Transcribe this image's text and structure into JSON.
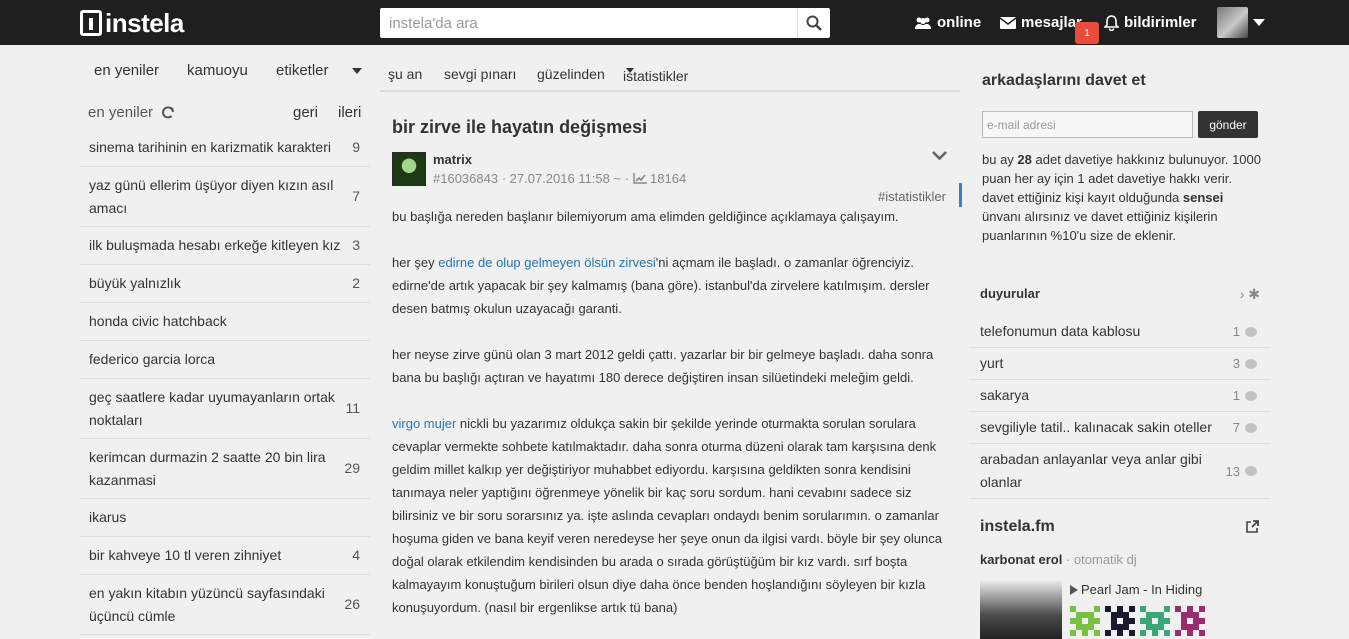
{
  "header": {
    "logo_text": "instela",
    "search_placeholder": "instela'da ara",
    "nav": {
      "online": "online",
      "messages": "mesajlar",
      "messages_badge": "1",
      "notifications": "bildirimler"
    }
  },
  "left": {
    "tabs": [
      "en yeniler",
      "kamuoyu",
      "etiketler"
    ],
    "list_title": "en yeniler",
    "back": "geri",
    "forward": "ileri",
    "topics": [
      {
        "title": "sinema tarihinin en karizmatik karakteri",
        "count": "9"
      },
      {
        "title": "yaz günü ellerim üşüyor diyen kızın asıl amacı",
        "count": "7"
      },
      {
        "title": "ilk buluşmada hesabı erkeğe kitleyen kız",
        "count": "3"
      },
      {
        "title": "büyük yalnızlık",
        "count": "2"
      },
      {
        "title": "honda civic hatchback",
        "count": ""
      },
      {
        "title": "federico garcia lorca",
        "count": ""
      },
      {
        "title": "geç saatlere kadar uyumayanların ortak noktaları",
        "count": "11"
      },
      {
        "title": "kerimcan durmazin 2 saatte 20 bin lira kazanmasi",
        "count": "29"
      },
      {
        "title": "ikarus",
        "count": ""
      },
      {
        "title": "bir kahveye 10 tl veren zihniyet",
        "count": "4"
      },
      {
        "title": "en yakın kitabın yüzüncü sayfasındaki üçüncü cümle",
        "count": "26"
      }
    ]
  },
  "middle": {
    "tabs": [
      "şu an",
      "sevgi pınarı",
      "güzelinden",
      "istatistikler"
    ],
    "entry_title": "bir zirve ile hayatın değişmesi",
    "author": "matrix",
    "entry_id": "#16036843",
    "date": "27.07.2016 11:58 ~",
    "views": "18164",
    "tag": "#istatistikler",
    "p1": "bu başlığa nereden başlanır bilemiyorum ama elimden geldiğince açıklamaya çalışayım.",
    "p2_pre": "her şey ",
    "p2_link": "edirne de olup gelmeyen ölsün zirvesi",
    "p2_post": "'ni açmam ile başladı. o zamanlar öğrenciyiz. edirne'de artık yapacak bir şey kalmamış (bana göre). istanbul'da zirvelere katılmışım. dersler desen batmış okulun uzayacağı garanti.",
    "p3": "her neyse zirve günü olan 3 mart 2012 geldi çattı. yazarlar bir bir gelmeye başladı. daha sonra bana bu başlığı açtıran ve hayatımı 180 derece değiştiren insan silüetindeki meleğim geldi.",
    "p4_link": "virgo mujer",
    "p4_post": " nickli bu yazarımız oldukça sakin bir şekilde yerinde oturmakta sorulan sorulara cevaplar vermekte sohbete katılmaktadır. daha sonra oturma düzeni olarak tam karşısına denk geldim millet kalkıp yer değiştiriyor muhabbet ediyordu. karşısına geldikten sonra kendisini tanımaya neler yaptığını öğrenmeye yönelik bir kaç soru sordum. hani cevabını sadece siz bilirsiniz ve bir soru sorarsınız ya. işte aslında cevapları ondaydı benim sorularımın. o zamanlar hoşuma giden ve bana keyif veren neredeyse her şeye onun da ilgisi vardı. böyle bir şey olunca doğal olarak etkilendim kendisinden bu arada o sırada görüştüğüm bir kız vardı. sırf boşta kalmayayım konuştuğum birileri olsun diye daha önce benden hoşlandığını söyleyen bir kızla konuşuyordum. (nasıl bir ergenlikse artık tü bana)"
  },
  "right": {
    "invite_title": "arkadaşlarını davet et",
    "email_placeholder": "e-mail adresi",
    "send": "gönder",
    "invite_a": "bu ay ",
    "invite_count": "28",
    "invite_b": " adet davetiye hakkınız bulunuyor. 1000 puan her ay için 1 adet davetiye hakkı verir. davet ettiğiniz kişi kayıt olduğunda ",
    "invite_bold": "sensei",
    "invite_c": " ünvanı alırsınız ve davet ettiğiniz kişilerin puanlarının %10'u size de eklenir.",
    "announcements_title": "duyurular",
    "announcements_more": "› ✱",
    "announcements": [
      {
        "title": "telefonumun data kablosu",
        "count": "1"
      },
      {
        "title": "yurt",
        "count": "3"
      },
      {
        "title": "sakarya",
        "count": "1"
      },
      {
        "title": "sevgiliyle tatil.. kalınacak sakin oteller",
        "count": "7"
      },
      {
        "title": "arabadan anlayanlar veya anlar gibi olanlar",
        "count": "13"
      }
    ],
    "fm_title": "instela.fm",
    "dj_name": "karbonat erol",
    "dj_sep": " · ",
    "dj_type": "otomatik dj",
    "track": "Pearl Jam - In Hiding",
    "pixel_colors": [
      "#7ac143",
      "#1a1a2e",
      "#3aa876",
      "#9b2d6f"
    ]
  }
}
